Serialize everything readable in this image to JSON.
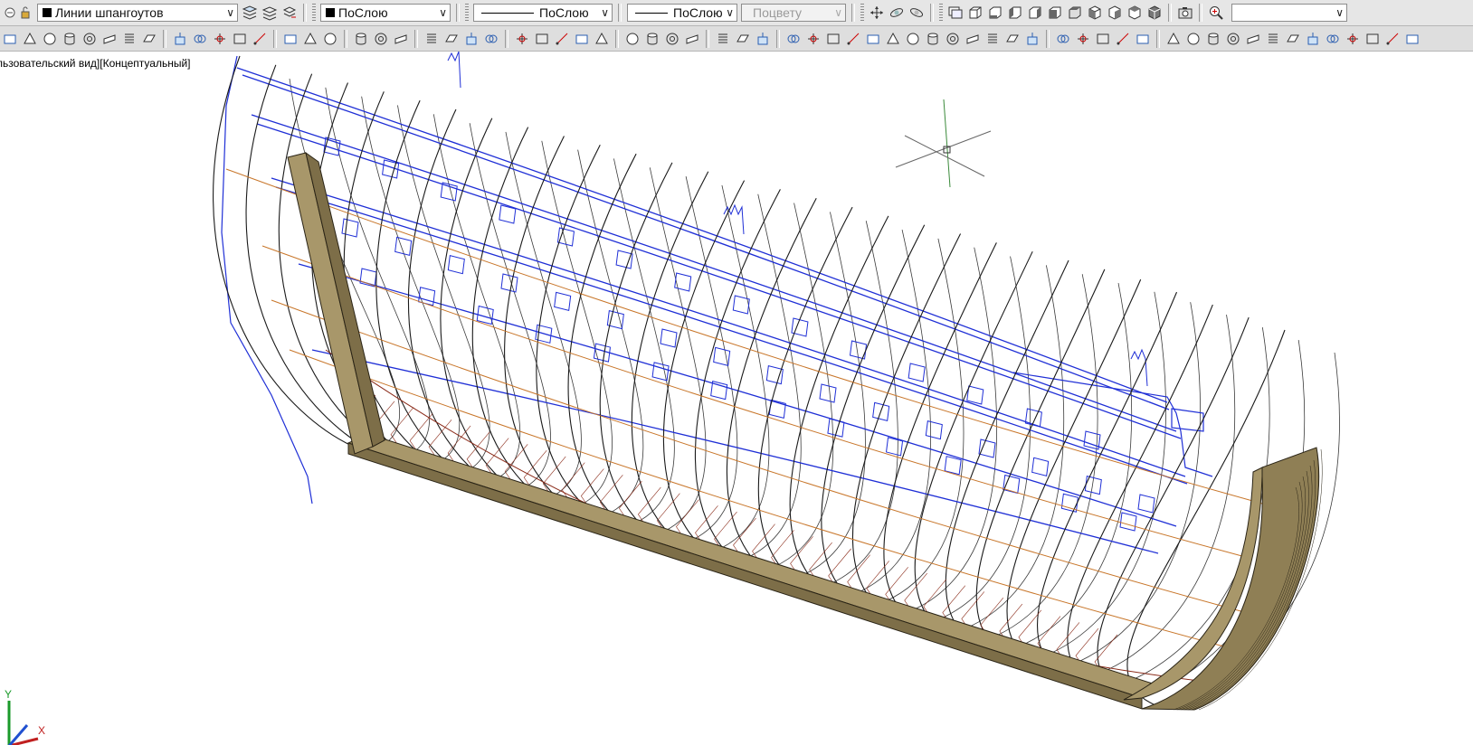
{
  "toolbar_top": {
    "layer_combo": {
      "value": "Линии шпангоутов",
      "swatch_color": "#000000"
    },
    "color_combo": {
      "value": "ПоСлою",
      "swatch_color": "#000000"
    },
    "linetype_combo": {
      "value": "ПоСлою"
    },
    "lineweight_combo": {
      "value": "ПоСлою"
    },
    "plotstyle_combo": {
      "value": "Поцвету"
    },
    "empty_combo": {
      "value": ""
    },
    "icons": [
      "layer-properties-icon",
      "layer-states-icon",
      "layer-previous-icon",
      "orbit-icon",
      "free-orbit-icon",
      "continuous-orbit-icon",
      "named-views-icon",
      "top-view-icon",
      "bottom-view-icon",
      "left-view-icon",
      "right-view-icon",
      "front-view-icon",
      "back-view-icon",
      "sw-iso-icon",
      "se-iso-icon",
      "ne-iso-icon",
      "nw-iso-icon",
      "camera-icon",
      "zoom-realtime-icon"
    ]
  },
  "toolbar_bottom": {
    "icons": [
      "polysolid-icon",
      "pyramid-icon",
      "sphere-icon",
      "cylinder-icon",
      "torus-icon",
      "wedge-icon",
      "helix-icon",
      "planar-surface-icon",
      "extrude-icon",
      "presspull-icon",
      "sweep-icon",
      "revolve-icon",
      "loft-icon",
      "union-icon",
      "subtract-icon",
      "intersect-icon",
      "3d-move-icon",
      "3d-rotate-icon",
      "3d-align-icon",
      "thicken-icon",
      "interference-icon",
      "slice-icon",
      "convert-icon",
      "extract-edges-icon",
      "imprint-icon",
      "color-faces-icon",
      "copy-faces-icon",
      "fillet-edge-icon",
      "box-face-icon",
      "extrude-face-icon",
      "move-face-icon",
      "offset-face-icon",
      "union-2-icon",
      "subtract-2-icon",
      "intersect-2-icon",
      "ucs-icon",
      "ucs-world-icon",
      "ucs-previous-icon",
      "ucs-face-icon",
      "ucs-object-icon",
      "ucs-view-icon",
      "ucs-origin-icon",
      "ucs-zaxis-icon",
      "ucs-3point-icon",
      "ucs-x-icon",
      "ucs-y-icon",
      "ucs-z-icon",
      "ucs-apply-icon",
      "visual-style-2d-icon",
      "visual-style-3d-icon",
      "hidden-icon",
      "realistic-icon",
      "conceptual-icon",
      "snap-endpoint-icon",
      "snap-midpoint-icon",
      "snap-intersection-icon",
      "snap-apparent-icon",
      "snap-extension-icon",
      "snap-center-icon",
      "snap-quadrant-icon",
      "snap-tangent-icon",
      "snap-perpendicular-icon",
      "snap-parallel-icon",
      "snap-insert-icon",
      "snap-node-icon",
      "snap-nearest-icon"
    ]
  },
  "viewport": {
    "label": "льзовательский вид][Концептуальный]",
    "ucs_labels": {
      "x": "X",
      "y": "Y"
    },
    "colors": {
      "frames": "#1a1a1a",
      "blue_structure": "#1f2fd6",
      "orange_lines": "#c8762a",
      "dark_red_lines": "#8a2a18",
      "keel_fill": "#a8976a",
      "keel_dark": "#7d6e48",
      "keel_edge": "#2a2416"
    }
  }
}
